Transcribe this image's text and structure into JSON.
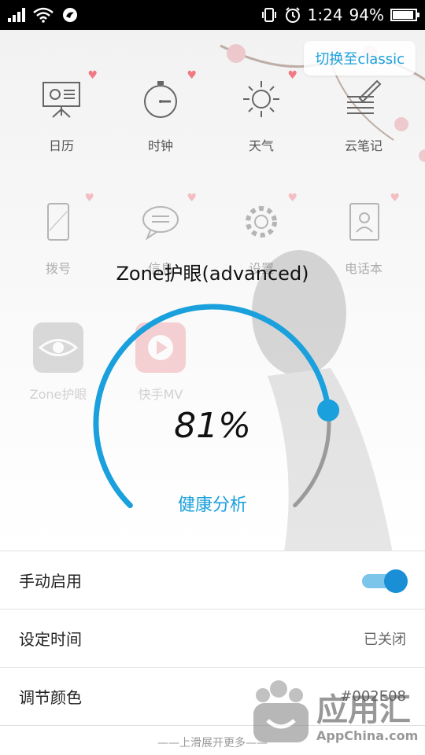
{
  "status_bar": {
    "time": "1:24",
    "battery": "94%",
    "battery_level": 0.94
  },
  "launcher": {
    "switch_label": "切换至classic",
    "apps": [
      {
        "label": "日历",
        "icon": "presentation-board-icon"
      },
      {
        "label": "时钟",
        "icon": "stopwatch-icon"
      },
      {
        "label": "天气",
        "icon": "sun-icon"
      },
      {
        "label": "云笔记",
        "icon": "notepad-pen-icon"
      },
      {
        "label": "拨号",
        "icon": "phone-icon"
      },
      {
        "label": "信息",
        "icon": "chat-bubble-icon"
      },
      {
        "label": "设置",
        "icon": "gear-icon"
      },
      {
        "label": "电话本",
        "icon": "contacts-book-icon"
      },
      {
        "label": "Zone护眼",
        "icon": "eye-icon"
      },
      {
        "label": "快手MV",
        "icon": "play-icon"
      }
    ]
  },
  "dial": {
    "title": "Zone护眼(advanced)",
    "value": "81%",
    "level": 0.81,
    "link_label": "健康分析",
    "accent": "#1aa0dc",
    "track": "#9a9a9a"
  },
  "settings": {
    "manual_label": "手动启用",
    "manual_on": true,
    "schedule_label": "设定时间",
    "schedule_value": "已关闭",
    "color_label": "调节颜色",
    "color_value": "#002E08"
  },
  "footer_hint": "——上滑展开更多——",
  "watermark": {
    "cn": "应用汇",
    "en": "AppChina.com"
  }
}
